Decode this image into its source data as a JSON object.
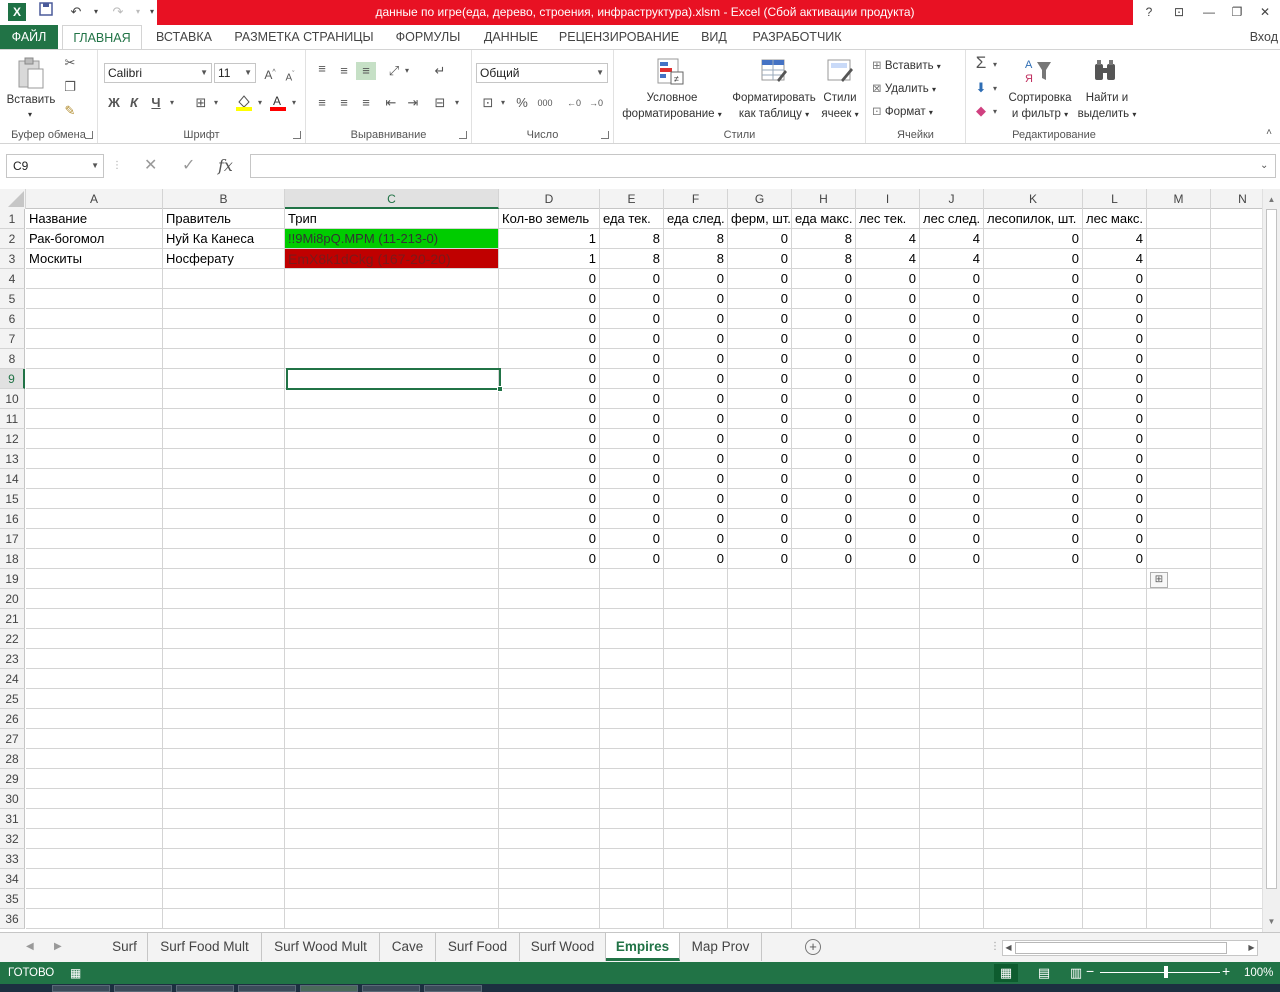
{
  "title_bar": {
    "text": "данные по игре(еда, дерево, строения, инфраструктура).xlsm -  Excel (Сбой активации продукта)",
    "app_icon": "X",
    "help": "?",
    "restore_ribbon": "⊡",
    "minimize": "—",
    "maximize": "❐",
    "close": "✕"
  },
  "ribbon_tabs": {
    "file": "ФАЙЛ",
    "home": "ГЛАВНАЯ",
    "insert": "ВСТАВКА",
    "page_layout": "РАЗМЕТКА СТРАНИЦЫ",
    "formulas": "ФОРМУЛЫ",
    "data": "ДАННЫЕ",
    "review": "РЕЦЕНЗИРОВАНИЕ",
    "view": "ВИД",
    "developer": "РАЗРАБОТЧИК",
    "login": "Вход"
  },
  "ribbon": {
    "clipboard": {
      "label": "Буфер обмена",
      "paste": "Вставить"
    },
    "font": {
      "label": "Шрифт",
      "font_name": "Calibri",
      "font_size": "11",
      "bold": "Ж",
      "italic": "К",
      "underline": "Ч"
    },
    "alignment": {
      "label": "Выравнивание"
    },
    "number": {
      "label": "Число",
      "format": "Общий",
      "percent": "%",
      "thousands": "000"
    },
    "styles": {
      "label": "Стили",
      "conditional_1": "Условное",
      "conditional_2": "форматирование",
      "format_table_1": "Форматировать",
      "format_table_2": "как таблицу",
      "cell_styles_1": "Стили",
      "cell_styles_2": "ячеек"
    },
    "cells": {
      "label": "Ячейки",
      "insert": "Вставить",
      "delete": "Удалить",
      "format": "Формат"
    },
    "editing": {
      "label": "Редактирование",
      "sort_1": "Сортировка",
      "sort_2": "и фильтр",
      "find_1": "Найти и",
      "find_2": "выделить"
    }
  },
  "formula_bar": {
    "name_box": "C9",
    "fx": "fx",
    "cancel": "✕",
    "enter": "✓",
    "value": ""
  },
  "columns": [
    "A",
    "B",
    "C",
    "D",
    "E",
    "F",
    "G",
    "H",
    "I",
    "J",
    "K",
    "L",
    "M",
    "N"
  ],
  "row_numbers": [
    "1",
    "2",
    "3",
    "4",
    "5",
    "6",
    "7",
    "8",
    "9",
    "10",
    "11",
    "12",
    "13",
    "14",
    "15",
    "16",
    "17",
    "18",
    "19",
    "20",
    "21",
    "22",
    "23",
    "24",
    "25",
    "26",
    "27",
    "28",
    "29",
    "30",
    "31",
    "32",
    "33",
    "34",
    "35",
    "36"
  ],
  "header_row": [
    "Название",
    "Правитель",
    "Трип",
    "Кол-во земель",
    "еда тек.",
    "еда след.",
    "ферм, шт.",
    "еда макс.",
    "лес тек.",
    "лес след.",
    "лесопилок, шт.",
    "лес макс."
  ],
  "data_rows": [
    [
      "Рак-богомол",
      "Нуй Ка Канеса",
      "!!9Mi8pQ.MPM (11-213-0)",
      "1",
      "8",
      "8",
      "0",
      "8",
      "4",
      "4",
      "0",
      "4"
    ],
    [
      "Москиты",
      "Носферату",
      "EmX8k1dCkg (167-20-20)",
      "1",
      "8",
      "8",
      "0",
      "8",
      "4",
      "4",
      "0",
      "4"
    ],
    [
      "",
      "",
      "",
      "0",
      "0",
      "0",
      "0",
      "0",
      "0",
      "0",
      "0",
      "0"
    ],
    [
      "",
      "",
      "",
      "0",
      "0",
      "0",
      "0",
      "0",
      "0",
      "0",
      "0",
      "0"
    ],
    [
      "",
      "",
      "",
      "0",
      "0",
      "0",
      "0",
      "0",
      "0",
      "0",
      "0",
      "0"
    ],
    [
      "",
      "",
      "",
      "0",
      "0",
      "0",
      "0",
      "0",
      "0",
      "0",
      "0",
      "0"
    ],
    [
      "",
      "",
      "",
      "0",
      "0",
      "0",
      "0",
      "0",
      "0",
      "0",
      "0",
      "0"
    ],
    [
      "",
      "",
      "",
      "0",
      "0",
      "0",
      "0",
      "0",
      "0",
      "0",
      "0",
      "0"
    ],
    [
      "",
      "",
      "",
      "0",
      "0",
      "0",
      "0",
      "0",
      "0",
      "0",
      "0",
      "0"
    ],
    [
      "",
      "",
      "",
      "0",
      "0",
      "0",
      "0",
      "0",
      "0",
      "0",
      "0",
      "0"
    ],
    [
      "",
      "",
      "",
      "0",
      "0",
      "0",
      "0",
      "0",
      "0",
      "0",
      "0",
      "0"
    ],
    [
      "",
      "",
      "",
      "0",
      "0",
      "0",
      "0",
      "0",
      "0",
      "0",
      "0",
      "0"
    ],
    [
      "",
      "",
      "",
      "0",
      "0",
      "0",
      "0",
      "0",
      "0",
      "0",
      "0",
      "0"
    ],
    [
      "",
      "",
      "",
      "0",
      "0",
      "0",
      "0",
      "0",
      "0",
      "0",
      "0",
      "0"
    ],
    [
      "",
      "",
      "",
      "0",
      "0",
      "0",
      "0",
      "0",
      "0",
      "0",
      "0",
      "0"
    ],
    [
      "",
      "",
      "",
      "0",
      "0",
      "0",
      "0",
      "0",
      "0",
      "0",
      "0",
      "0"
    ],
    [
      "",
      "",
      "",
      "0",
      "0",
      "0",
      "0",
      "0",
      "0",
      "0",
      "0",
      "0"
    ]
  ],
  "selected_cell": "C9",
  "sheet_tabs": [
    "Surf",
    "Surf Food Mult",
    "Surf Wood Mult",
    "Cave",
    "Surf Food",
    "Surf Wood",
    "Empires",
    "Map Prov"
  ],
  "active_sheet": "Empires",
  "status": {
    "ready": "ГОТОВО",
    "zoom": "100%"
  },
  "colors": {
    "accent": "#217346",
    "green_cell": "#00cc00",
    "red_cell": "#c00000",
    "title_red": "#e81123"
  }
}
